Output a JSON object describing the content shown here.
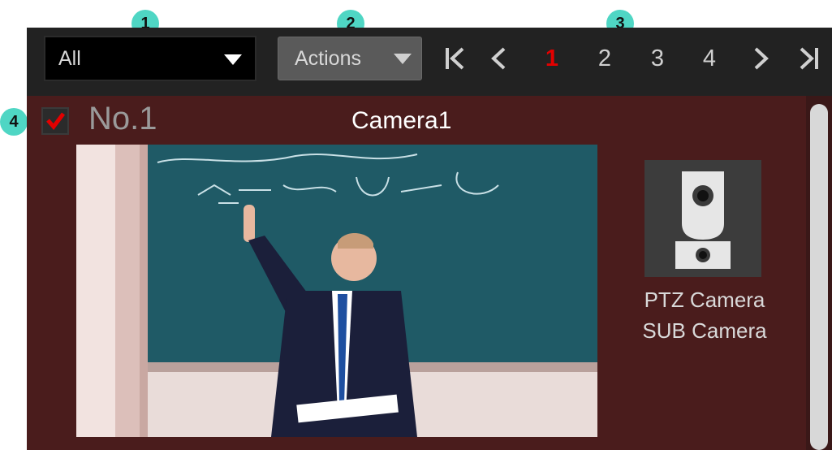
{
  "callouts": [
    "1",
    "2",
    "3",
    "4"
  ],
  "filter": {
    "value": "All"
  },
  "actions": {
    "label": "Actions"
  },
  "pager": {
    "pages": [
      "1",
      "2",
      "3",
      "4"
    ],
    "current": "1"
  },
  "camera": {
    "checked": true,
    "number": "No.1",
    "name": "Camera1",
    "type_line1": "PTZ Camera",
    "type_line2": "SUB Camera"
  },
  "colors": {
    "callout": "#4fd6c4",
    "toolbar": "#222222",
    "panel": "#4a1c1c",
    "current_page": "#e30000",
    "check": "#e30000"
  },
  "icons": [
    "first-page-icon",
    "prev-page-icon",
    "next-page-icon",
    "last-page-icon",
    "checkmark-icon",
    "ptz-camera-icon",
    "dropdown-arrow-icon"
  ]
}
